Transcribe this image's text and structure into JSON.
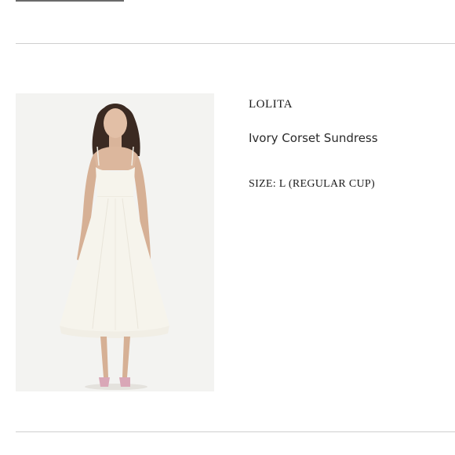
{
  "product": {
    "brand": "LOLITA",
    "name": "Ivory Corset Sundress",
    "size_line": "SIZE: L (REGULAR CUP)"
  },
  "image": {
    "subject": "model wearing ivory midi sundress",
    "background_color": "#f3f3f1",
    "dress_color": "#f6f4ec",
    "shoe_color": "#d9a7b7"
  }
}
